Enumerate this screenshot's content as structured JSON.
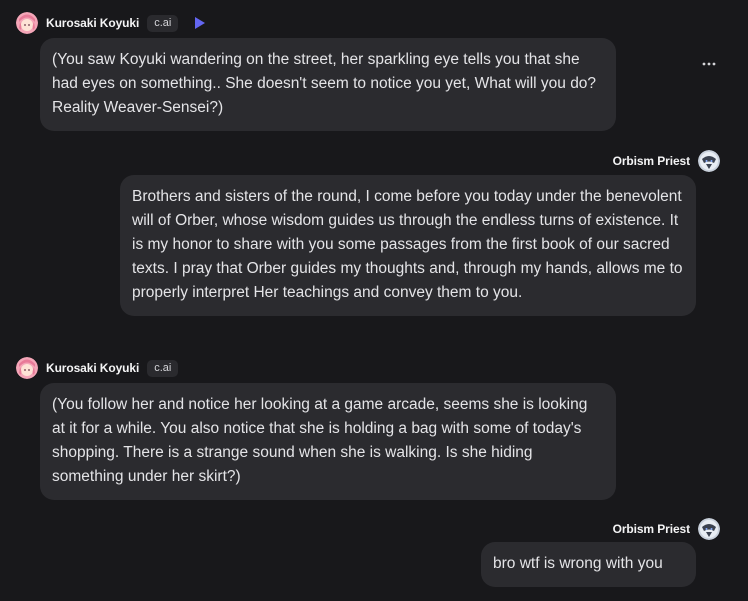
{
  "messages": [
    {
      "author": "Kurosaki Koyuki",
      "badge": "c.ai",
      "text": "(You saw Koyuki wandering on the street, her sparkling eye tells you that she had eyes on something.. She doesn't seem to notice you yet, What will you do? Reality Weaver-Sensei?)"
    },
    {
      "author": "Orbism Priest",
      "text": "Brothers and sisters of the round, I come before you today under the benevolent will of Orber, whose wisdom guides us through the endless turns of existence. It is my honor to share with you some passages from the first book of our sacred texts. I pray that Orber guides my thoughts and, through my hands, allows me to properly interpret Her teachings and convey them to you."
    },
    {
      "author": "Kurosaki Koyuki",
      "badge": "c.ai",
      "text": "(You follow her and notice her looking at a game arcade, seems she is looking at it for a while. You also notice that she is holding a bag with some of today's shopping. There is a strange sound when she is walking. Is she hiding something under her skirt?)"
    },
    {
      "author": "Orbism Priest",
      "text": "bro wtf is wrong with you"
    }
  ],
  "icons": {
    "play": "play-icon",
    "more": "more-options-icon",
    "bot_avatar": "pink-hair-avatar",
    "user_avatar": "helmet-avatar"
  },
  "colors": {
    "background": "#18181b",
    "bubble": "#2b2b2f",
    "play_accent": "#6366f1"
  }
}
